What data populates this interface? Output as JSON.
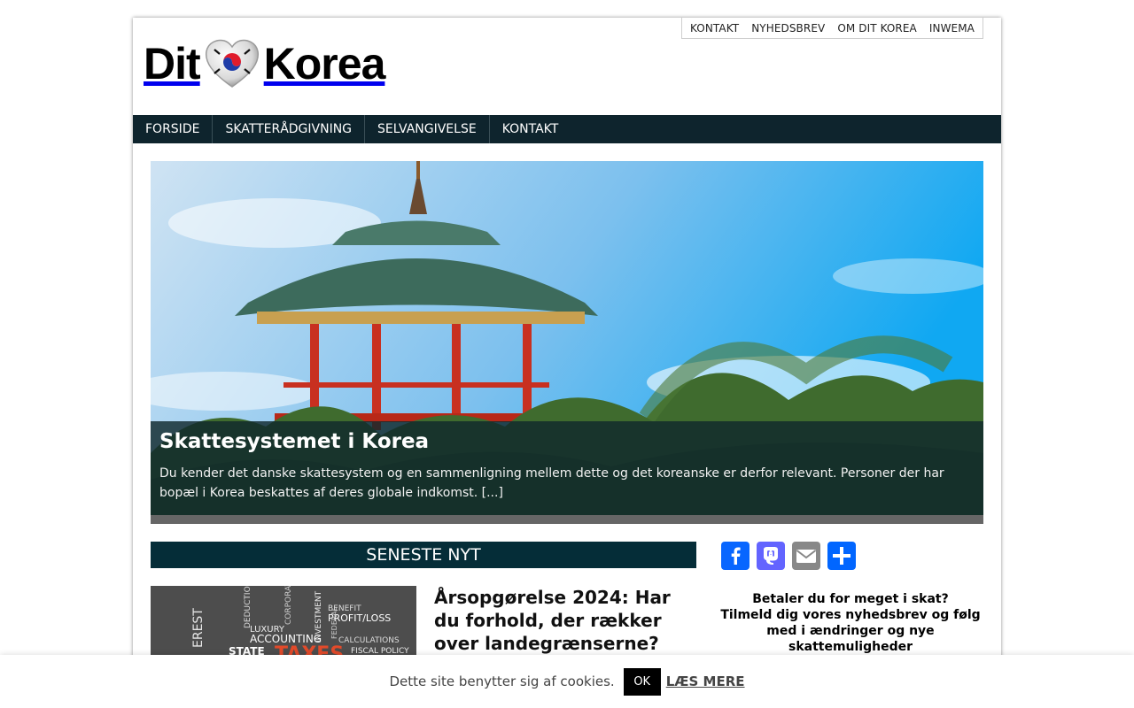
{
  "topnav": {
    "items": [
      "KONTAKT",
      "NYHEDSBREV",
      "OM DIT KOREA",
      "INWEMA"
    ]
  },
  "logo": {
    "left": "Dit",
    "right": "Korea"
  },
  "mainnav": {
    "items": [
      "FORSIDE",
      "SKATTERÅDGIVNING",
      "SELVANGIVELSE",
      "KONTAKT"
    ]
  },
  "hero": {
    "title": "Skattesystemet i Korea",
    "excerpt": "Du kender det danske skattesystem og en sammenligning mellem dette og det koreanske er derfor relevant. Personer der har bopæl i Korea beskattes af deres globale indkomst. [...]"
  },
  "latest": {
    "heading": "SENESTE NYT",
    "post_title": "Årsopgørelse 2024: Har du forhold, der rækker over landegrænserne?",
    "thumb_words": [
      "EREST",
      "DEDUCTIONS",
      "LUXURY",
      "ACCOUNTING",
      "CORPORATE",
      "INVESTMENT",
      "BENEFIT",
      "PROFIT/LOSS",
      "FEDERAL",
      "CALCULATIONS",
      "STATE",
      "TAXES",
      "FISCAL POLICY"
    ]
  },
  "share": {
    "icons": [
      "facebook-icon",
      "mastodon-icon",
      "email-icon",
      "share-icon"
    ]
  },
  "promo": {
    "line1": "Betaler du for meget i skat?",
    "line2": "Tilmeld dig vores nyhedsbrev og følg med i ændringer og nye skattemuligheder"
  },
  "cookie": {
    "message": "Dette site benytter sig af cookies.",
    "ok": "OK",
    "more": "LÆS MERE"
  },
  "colors": {
    "nav_bg": "#0e242d",
    "section_head": "#052d38",
    "facebook": "#0866ff",
    "mastodon": "#6364ff",
    "email": "#888888",
    "share": "#0166ff"
  }
}
